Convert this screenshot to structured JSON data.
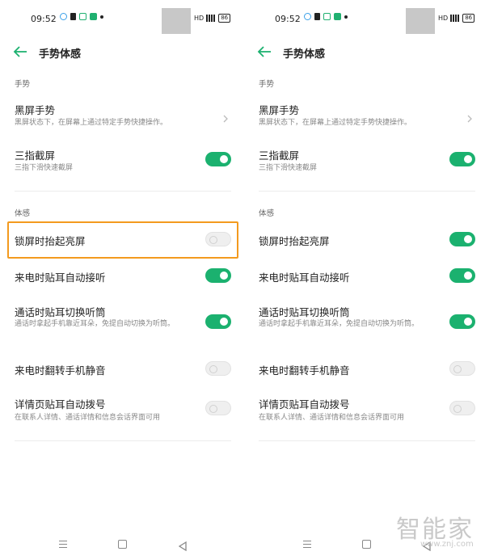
{
  "status": {
    "time": "09:52",
    "hd": "HD",
    "battery": "86"
  },
  "header": {
    "title": "手势体感"
  },
  "sections": {
    "gesture": "手势",
    "motion": "体感"
  },
  "rows": {
    "screen_off": {
      "title": "黑屏手势",
      "subtitle": "黑屏状态下，在屏幕上通过特定手势快捷操作。"
    },
    "three_finger": {
      "title": "三指截屏",
      "subtitle": "三指下滑快速截屏"
    },
    "raise_to_wake": {
      "title": "锁屏时抬起亮屏"
    },
    "auto_answer": {
      "title": "来电时贴耳自动接听"
    },
    "switch_earpiece": {
      "title": "通话时贴耳切换听筒",
      "subtitle": "通话时拿起手机靠近耳朵，免提自动切换为听筒。"
    },
    "flip_mute": {
      "title": "来电时翻转手机静音"
    },
    "auto_dial": {
      "title": "详情页贴耳自动拨号",
      "subtitle": "在联系人详情、通话详情和信息会话界面可用"
    }
  },
  "toggles": {
    "left": {
      "three_finger": true,
      "raise_to_wake": false,
      "auto_answer": true,
      "switch_earpiece": true,
      "flip_mute": false,
      "auto_dial": false
    },
    "right": {
      "three_finger": true,
      "raise_to_wake": true,
      "auto_answer": true,
      "switch_earpiece": true,
      "flip_mute": false,
      "auto_dial": false
    }
  },
  "colors": {
    "accent": "#1bb16f",
    "highlight": "#f39a1e"
  },
  "icons": [
    "back-arrow-icon",
    "chevron-right-icon",
    "menu-icon",
    "home-icon",
    "back-triangle-icon"
  ],
  "watermark": {
    "text": "智能家",
    "url": "www.znj.com"
  }
}
